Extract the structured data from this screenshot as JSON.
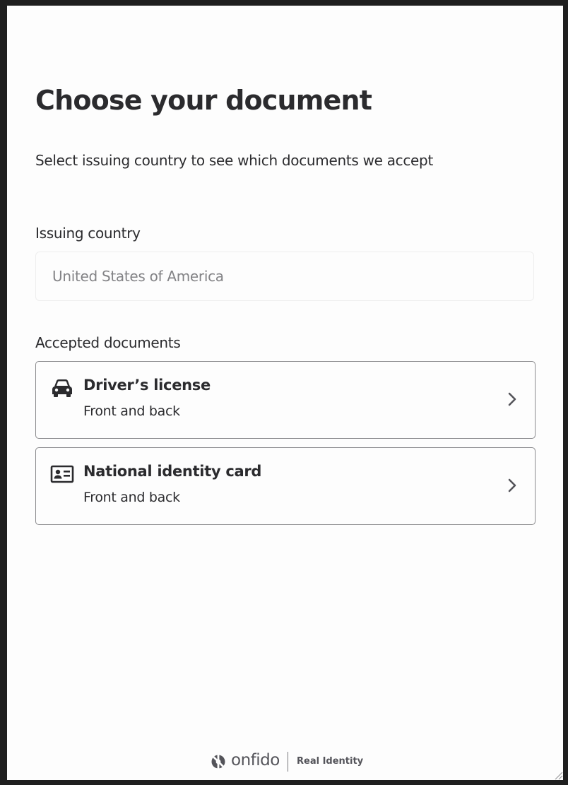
{
  "header": {
    "title": "Choose your document",
    "subtitle": "Select issuing country to see which documents we accept"
  },
  "country": {
    "label": "Issuing country",
    "value": "United States of America"
  },
  "documents": {
    "label": "Accepted documents",
    "items": [
      {
        "title": "Driver’s license",
        "subtitle": "Front and back",
        "icon": "car-icon"
      },
      {
        "title": "National identity card",
        "subtitle": "Front and back",
        "icon": "id-card-icon"
      }
    ]
  },
  "footer": {
    "brand": "onfido",
    "tagline": "Real Identity"
  },
  "colors": {
    "text": "#2b2b2e",
    "muted": "#838386",
    "border": "#8a8a8d",
    "background": "#fdfdfd"
  }
}
